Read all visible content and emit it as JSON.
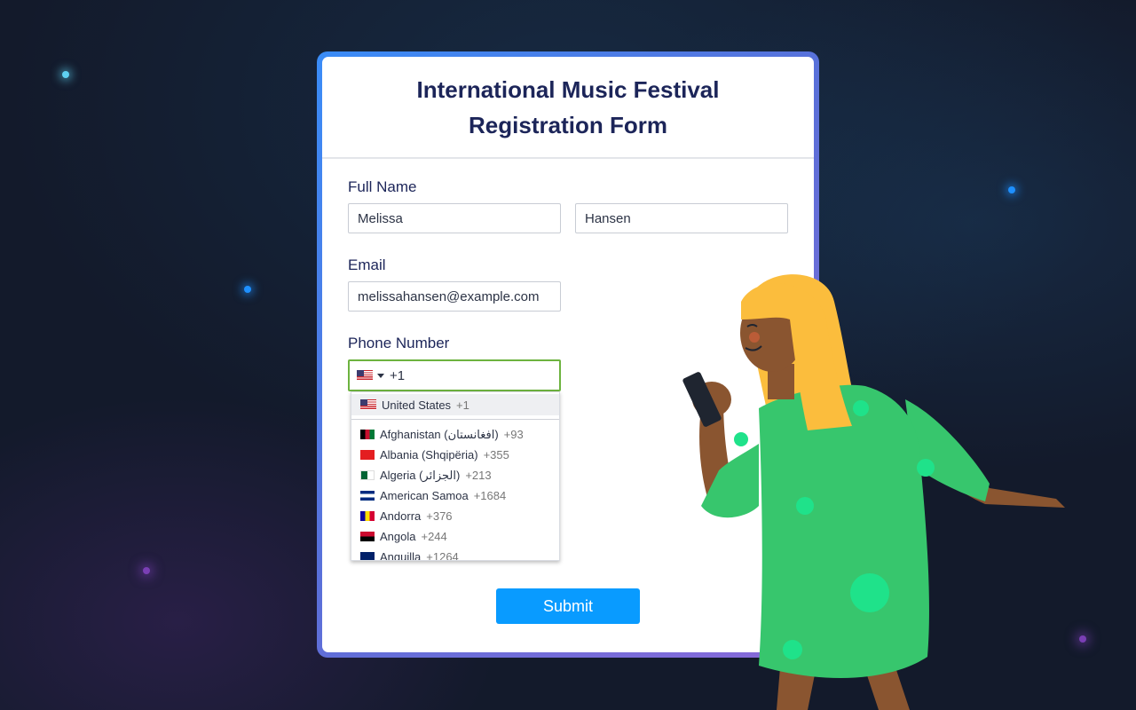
{
  "form": {
    "title": "International Music Festival Registration Form",
    "full_name_label": "Full Name",
    "first_name": "Melissa",
    "last_name": "Hansen",
    "email_label": "Email",
    "email": "melissahansen@example.com",
    "phone_label": "Phone Number",
    "phone_value": "+1",
    "submit_label": "Submit"
  },
  "country_dropdown": {
    "selected": {
      "name": "United States",
      "code": "+1",
      "flag": "flag-us-icon"
    },
    "items": [
      {
        "name": "Afghanistan (‫افغانستان‬‎)",
        "code": "+93",
        "flag": "flag-af-icon"
      },
      {
        "name": "Albania (Shqipëria)",
        "code": "+355",
        "flag": "flag-al-icon"
      },
      {
        "name": "Algeria (‫الجزائر‬‎)",
        "code": "+213",
        "flag": "flag-dz-icon"
      },
      {
        "name": "American Samoa",
        "code": "+1684",
        "flag": "flag-as-icon"
      },
      {
        "name": "Andorra",
        "code": "+376",
        "flag": "flag-ad-icon"
      },
      {
        "name": "Angola",
        "code": "+244",
        "flag": "flag-ao-icon"
      },
      {
        "name": "Anguilla",
        "code": "+1264",
        "flag": "flag-ai-icon"
      }
    ]
  },
  "colors": {
    "title": "#1c2559",
    "submit_bg": "#099bff",
    "phone_focus_border": "#6db33f",
    "background": "#131a2b"
  }
}
